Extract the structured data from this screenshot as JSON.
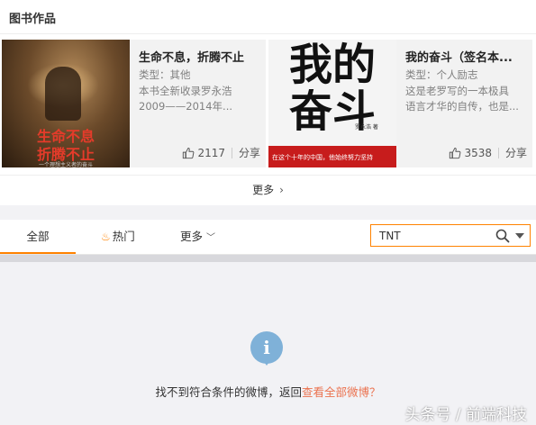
{
  "section": {
    "title": "图书作品"
  },
  "books": [
    {
      "cover_title_line1": "生命不息",
      "cover_title_line2": "折腾不止",
      "cover_subtitle": "一个理想主义者的奋斗",
      "title": "生命不息，折腾不止",
      "type": "类型：其他",
      "desc_line1": "本书全新收录罗永浩",
      "desc_line2": "2009——2014年...",
      "likes": "2117",
      "share": "分享"
    },
    {
      "cover_title_line1": "我的",
      "cover_title_line2": "奋斗",
      "cover_author": "罗永浩 著",
      "cover_band": "在这个十年的中国，他始终努力坚持",
      "title": "我的奋斗（签名本...",
      "type": "类型：个人励志",
      "desc_line1": "这是老罗写的一本极具",
      "desc_line2": "语言才华的自传，也是...",
      "likes": "3538",
      "share": "分享"
    }
  ],
  "more": {
    "label": "更多"
  },
  "tabs": {
    "all": "全部",
    "hot": "热门",
    "more": "更多"
  },
  "search": {
    "value": "TNT",
    "placeholder": ""
  },
  "empty": {
    "message": "找不到符合条件的微博，返回",
    "link": "查看全部微博？"
  },
  "watermark": "头条号 / 前端科技",
  "colors": {
    "accent": "#ff8200",
    "link": "#eb7350",
    "info": "#7fb1d8"
  }
}
